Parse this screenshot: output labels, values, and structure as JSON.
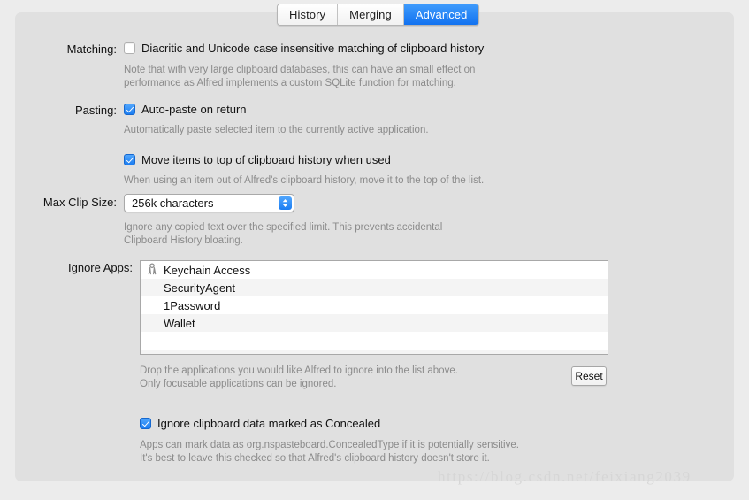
{
  "tabs": [
    {
      "label": "History",
      "active": false
    },
    {
      "label": "Merging",
      "active": false
    },
    {
      "label": "Advanced",
      "active": true
    }
  ],
  "matching": {
    "label": "Matching:",
    "checkbox_label": "Diacritic and Unicode case insensitive matching of clipboard history",
    "checked": false,
    "help_line1": "Note that with very large clipboard databases, this can have an small effect on",
    "help_line2": "performance as Alfred implements a custom SQLite function for matching."
  },
  "pasting": {
    "label": "Pasting:",
    "option1_label": "Auto-paste on return",
    "option1_checked": true,
    "option1_help": "Automatically paste selected item to the currently active application.",
    "option2_label": "Move items to top of clipboard history when used",
    "option2_checked": true,
    "option2_help": "When using an item out of Alfred's clipboard history, move it to the top of the list."
  },
  "max_clip_size": {
    "label": "Max Clip Size:",
    "value": "256k characters",
    "help_line1": "Ignore any copied text over the specified limit. This prevents accidental",
    "help_line2": "Clipboard History bloating."
  },
  "ignore_apps": {
    "label": "Ignore Apps:",
    "rows": [
      {
        "name": "Keychain Access",
        "icon": "keychain-icon"
      },
      {
        "name": "SecurityAgent",
        "icon": null
      },
      {
        "name": "1Password",
        "icon": null
      },
      {
        "name": "Wallet",
        "icon": null
      },
      {
        "name": "",
        "icon": null
      },
      {
        "name": "",
        "icon": null
      }
    ],
    "help_line1": "Drop the applications you would like Alfred to ignore into the list above.",
    "help_line2": "Only focusable applications can be ignored.",
    "reset_label": "Reset"
  },
  "concealed": {
    "checkbox_label": "Ignore clipboard data marked as Concealed",
    "checked": true,
    "help_line1": "Apps can mark data as org.nspasteboard.ConcealedType if it is potentially sensitive.",
    "help_line2": "It's best to leave this checked so that Alfred's clipboard history doesn't store it."
  },
  "watermark": "https://blog.csdn.net/feixiang2039",
  "colors": {
    "accent": "#1b7df2",
    "panel": "#e0e0e0",
    "page": "#ececec",
    "help_text": "#8b8b8b"
  }
}
